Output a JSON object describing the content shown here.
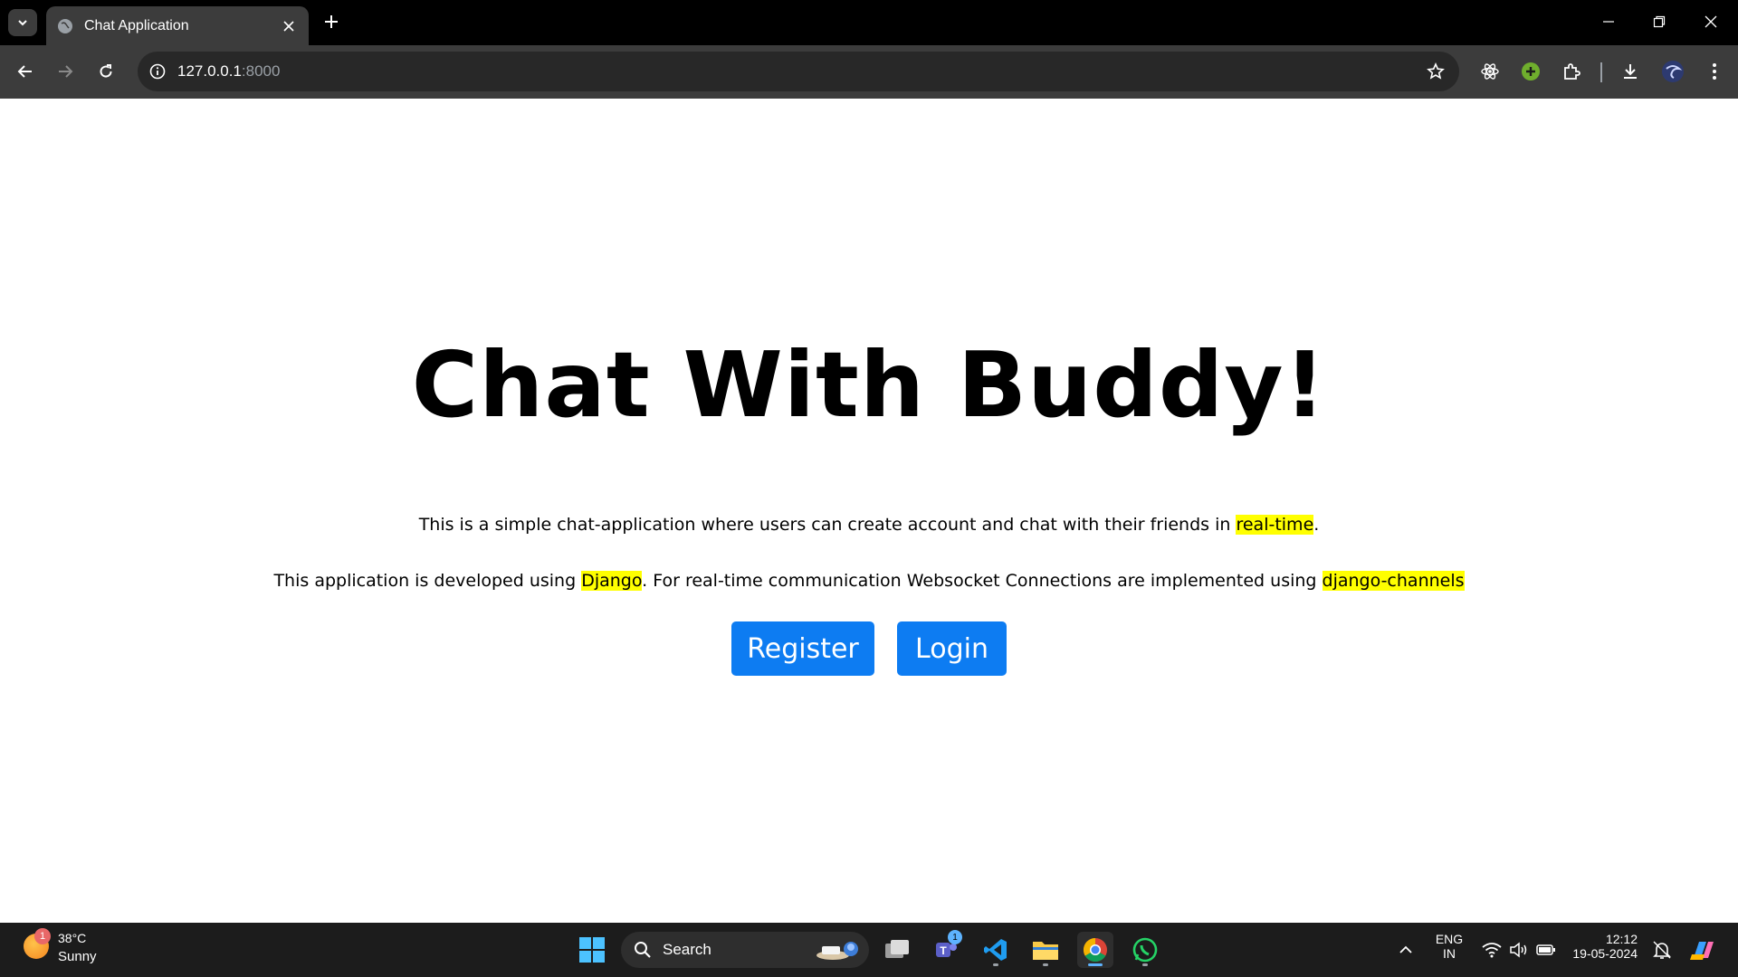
{
  "browser": {
    "tab_title": "Chat Application",
    "url_host": "127.0.0.1",
    "url_port": ":8000"
  },
  "page": {
    "heading": "Chat With Buddy!",
    "para1": {
      "text_before": "This is a simple chat-application where users can create account and chat with their friends in ",
      "highlight": "real-time",
      "text_after": "."
    },
    "para2": {
      "text_before": "This application is developed using ",
      "highlight1": "Django",
      "text_middle": ". For real-time communication Websocket Connections are implemented using ",
      "highlight2": "django-channels"
    },
    "register_label": "Register",
    "login_label": "Login"
  },
  "taskbar": {
    "weather_badge": "1",
    "weather_temp": "38°C",
    "weather_condition": "Sunny",
    "search_label": "Search",
    "teams_badge": "1",
    "lang_line1": "ENG",
    "lang_line2": "IN",
    "time": "12:12",
    "date": "19-05-2024"
  },
  "colors": {
    "button_bg": "#0d7cf2",
    "highlight": "#ffff00",
    "chrome_dark": "#3c3c3c"
  }
}
